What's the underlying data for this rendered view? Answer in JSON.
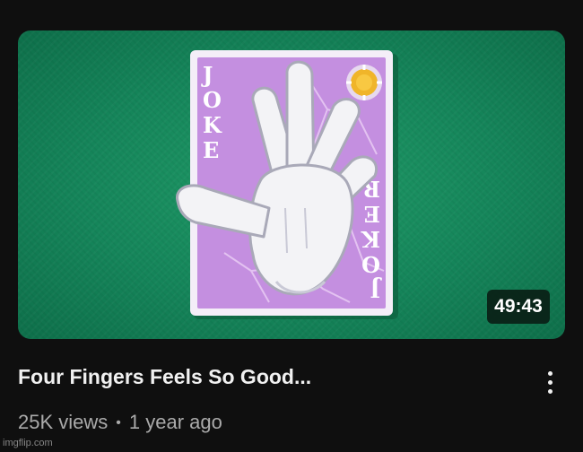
{
  "video": {
    "title": "Four Fingers Feels So Good...",
    "duration": "49:43",
    "views": "25K views",
    "separator": "•",
    "age": "1 year ago"
  },
  "thumbnail": {
    "card_text": "JOKER",
    "card_text_reversed": "JOKER",
    "felt_color": "#1a8f5f",
    "card_color": "#c48fe0",
    "glove_color": "#f3f3f6"
  },
  "watermark": "imgflip.com",
  "icons": {
    "menu": "more-vert-icon",
    "chip": "poker-chip-icon",
    "glove": "white-glove-icon"
  }
}
